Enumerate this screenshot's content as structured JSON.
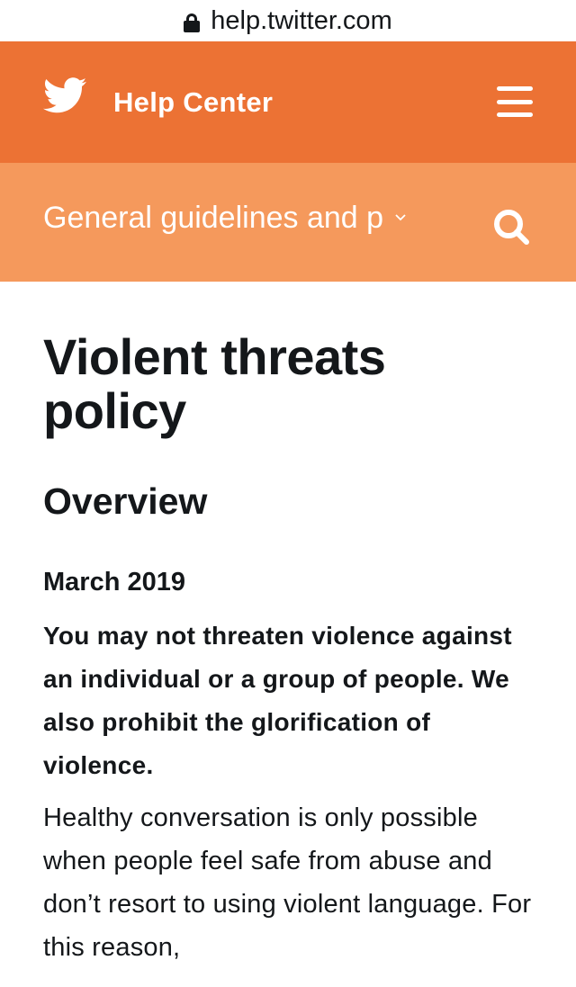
{
  "browser": {
    "url": "help.twitter.com",
    "lock_icon": "lock-icon"
  },
  "header": {
    "logo_icon": "twitter-bird-icon",
    "title": "Help Center",
    "menu_icon": "hamburger-menu-icon",
    "brand_color": "#ec7234"
  },
  "subnav": {
    "section_label": "General guidelines and p",
    "chevron_icon": "chevron-down-icon",
    "search_icon": "search-icon",
    "background_color": "#f5995c"
  },
  "article": {
    "title": "Violent threats policy",
    "section_heading": "Overview",
    "date": "March 2019",
    "lead": "You may not threaten violence against an individual or a group of people. We also prohibit the glorification of violence.",
    "body": "Healthy conversation is only possible when people feel safe from abuse and don’t resort to using violent language. For this reason,"
  }
}
